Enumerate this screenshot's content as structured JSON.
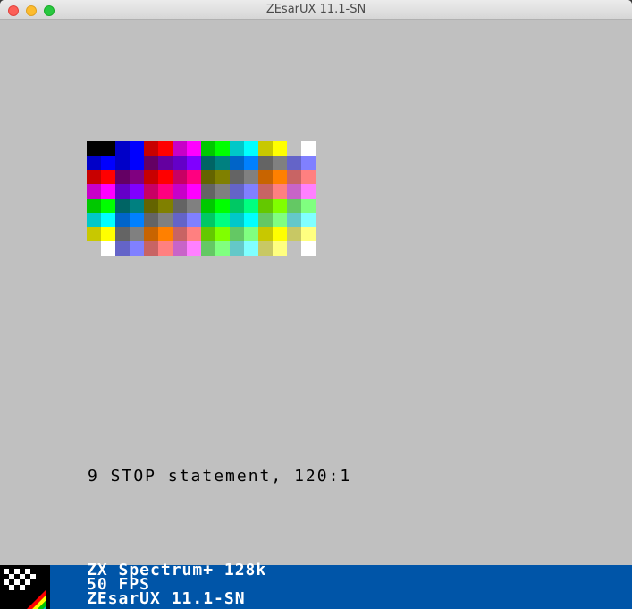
{
  "window": {
    "title": "ZEsarUX 11.1-SN"
  },
  "screen": {
    "background": "#c0c0c0",
    "message": "9 STOP statement, 120:1",
    "palette_rows": [
      [
        "#000000",
        "#000000",
        "#0000c8",
        "#0000ff",
        "#c80000",
        "#ff0000",
        "#c800c8",
        "#ff00ff",
        "#00c800",
        "#00ff00",
        "#00c8c8",
        "#00ffff",
        "#c8c800",
        "#ffff00",
        "#c0c0c0",
        "#ffffff"
      ],
      [
        "#0000c8",
        "#0000ff",
        "#0000c8",
        "#0000ff",
        "#640064",
        "#6400a0",
        "#6400c8",
        "#8000ff",
        "#006464",
        "#008080",
        "#0064c8",
        "#0080ff",
        "#646464",
        "#808080",
        "#6464c8",
        "#8080ff"
      ],
      [
        "#c80000",
        "#ff0000",
        "#640064",
        "#800080",
        "#c80000",
        "#ff0000",
        "#c80064",
        "#ff0080",
        "#646400",
        "#808000",
        "#646464",
        "#808080",
        "#c86400",
        "#ff8000",
        "#c86464",
        "#ff8080"
      ],
      [
        "#c800c8",
        "#ff00ff",
        "#6400c8",
        "#8000ff",
        "#c80064",
        "#ff0080",
        "#c800c8",
        "#ff00ff",
        "#646464",
        "#808080",
        "#6464c8",
        "#8080ff",
        "#c86464",
        "#ff8080",
        "#c864c8",
        "#ff80ff"
      ],
      [
        "#00c800",
        "#00ff00",
        "#006464",
        "#008080",
        "#646400",
        "#808000",
        "#646464",
        "#808080",
        "#00c800",
        "#00ff00",
        "#00c864",
        "#00ff80",
        "#64c800",
        "#80ff00",
        "#64c864",
        "#80ff80"
      ],
      [
        "#00c8c8",
        "#00ffff",
        "#0064c8",
        "#0080ff",
        "#646464",
        "#808080",
        "#6464c8",
        "#8080ff",
        "#00c864",
        "#00ff80",
        "#00c8c8",
        "#00ffff",
        "#64c864",
        "#80ff80",
        "#64c8c8",
        "#80ffff"
      ],
      [
        "#c8c800",
        "#ffff00",
        "#646464",
        "#808080",
        "#c86400",
        "#ff8000",
        "#c86464",
        "#ff8080",
        "#64c800",
        "#80ff00",
        "#64c864",
        "#80ff80",
        "#c8c800",
        "#ffff00",
        "#c8c864",
        "#ffff80"
      ],
      [
        "#c0c0c0",
        "#ffffff",
        "#6464c8",
        "#8080ff",
        "#c86464",
        "#ff8080",
        "#c864c8",
        "#ff80ff",
        "#64c864",
        "#80ff80",
        "#64c8c8",
        "#80ffff",
        "#c8c864",
        "#ffff80",
        "#c0c0c0",
        "#ffffff"
      ]
    ]
  },
  "footer": {
    "background": "#0055a8",
    "machine": "ZX Spectrum+ 128k",
    "fps": "50 FPS",
    "version": "ZEsarUX 11.1-SN",
    "logo_icon": "zx-spectrum-rainbow-stripes-icon"
  }
}
